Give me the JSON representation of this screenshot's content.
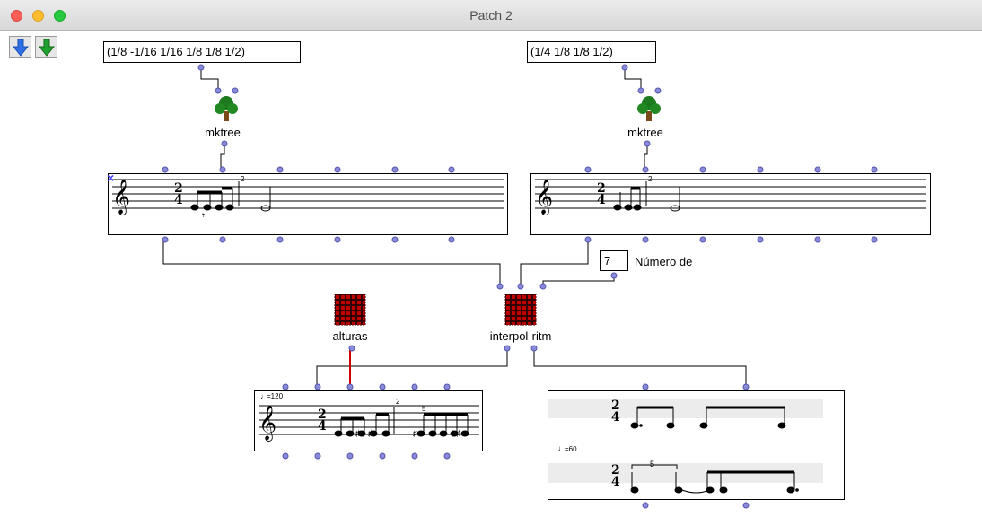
{
  "window": {
    "title": "Patch 2"
  },
  "toolbar": {
    "down_blue": "blue-down-arrow-icon",
    "down_green": "green-down-arrow-icon"
  },
  "boxes": {
    "list_left": "(1/8 -1/16 1/16 1/8 1/8 1/2)",
    "list_right": "(1/4 1/8 1/8 1/2)",
    "mktree_left": "mktree",
    "mktree_right": "mktree",
    "number_value": "7",
    "number_comment": "Número de",
    "alturas": "alturas",
    "interpol": "interpol-ritm"
  },
  "score_marks": {
    "tuplet": "2",
    "tuplet5": "5",
    "time_num": "2",
    "time_den": "4",
    "tempo": "=120",
    "tempo2": "=60"
  }
}
